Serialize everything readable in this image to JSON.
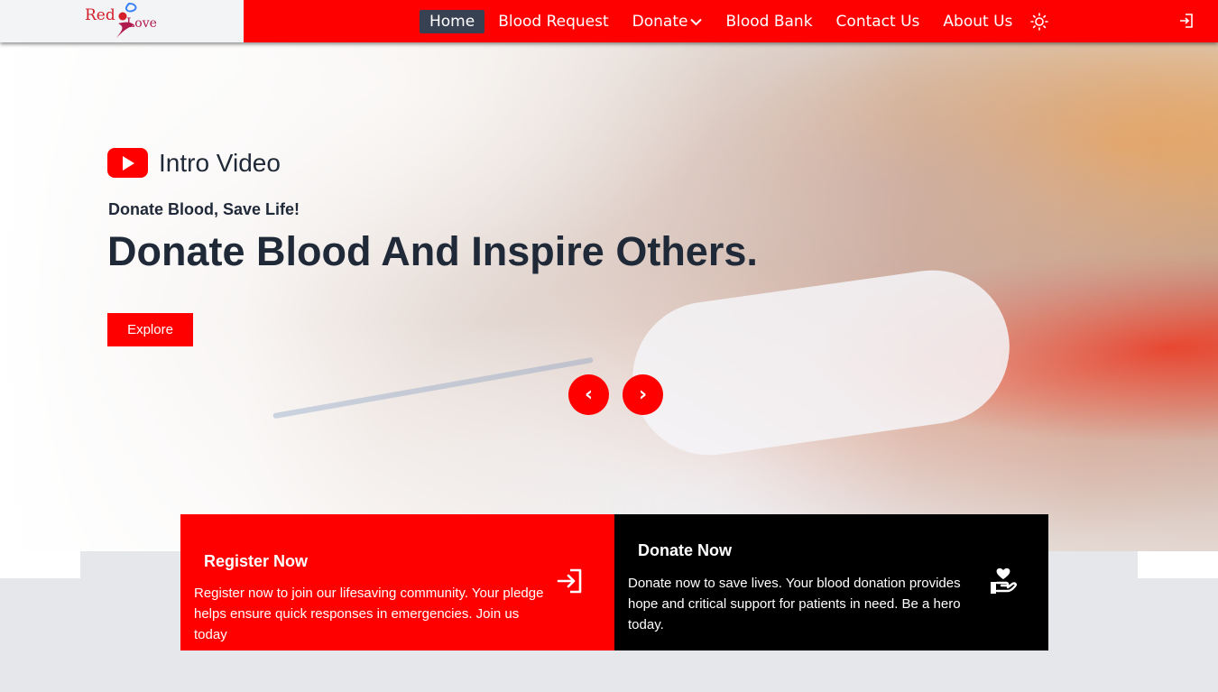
{
  "brand": {
    "logo_word_1": "Red",
    "logo_word_2": "Love"
  },
  "nav": {
    "items": [
      {
        "label": "Home",
        "active": true
      },
      {
        "label": "Blood Request"
      },
      {
        "label": "Donate",
        "has_dropdown": true
      },
      {
        "label": "Blood Bank"
      },
      {
        "label": "Contact Us"
      },
      {
        "label": "About Us"
      }
    ],
    "theme_icon": "sun-icon",
    "login_icon": "login-icon"
  },
  "hero": {
    "video_label": "Intro Video",
    "eyebrow": "Donate Blood, Save Life!",
    "headline": "Donate Blood And Inspire Others.",
    "cta_label": "Explore",
    "prev_symbol": "‹",
    "next_symbol": "›"
  },
  "cards": {
    "register": {
      "title": "Register Now",
      "text": "Register now to join our lifesaving community. Your pledge helps ensure quick responses in emergencies. Join us today",
      "icon": "sign-in-icon"
    },
    "donate": {
      "title": "Donate Now",
      "text": "Donate now to save lives. Your blood donation provides hope and critical support for patients in need. Be a hero today.",
      "icon": "hand-holding-heart-icon"
    }
  },
  "colors": {
    "accent": "#ff0000",
    "dark": "#1f2937",
    "nav_active_bg": "#374151",
    "page_bg": "#e5e7eb",
    "card_dark": "#000000"
  }
}
